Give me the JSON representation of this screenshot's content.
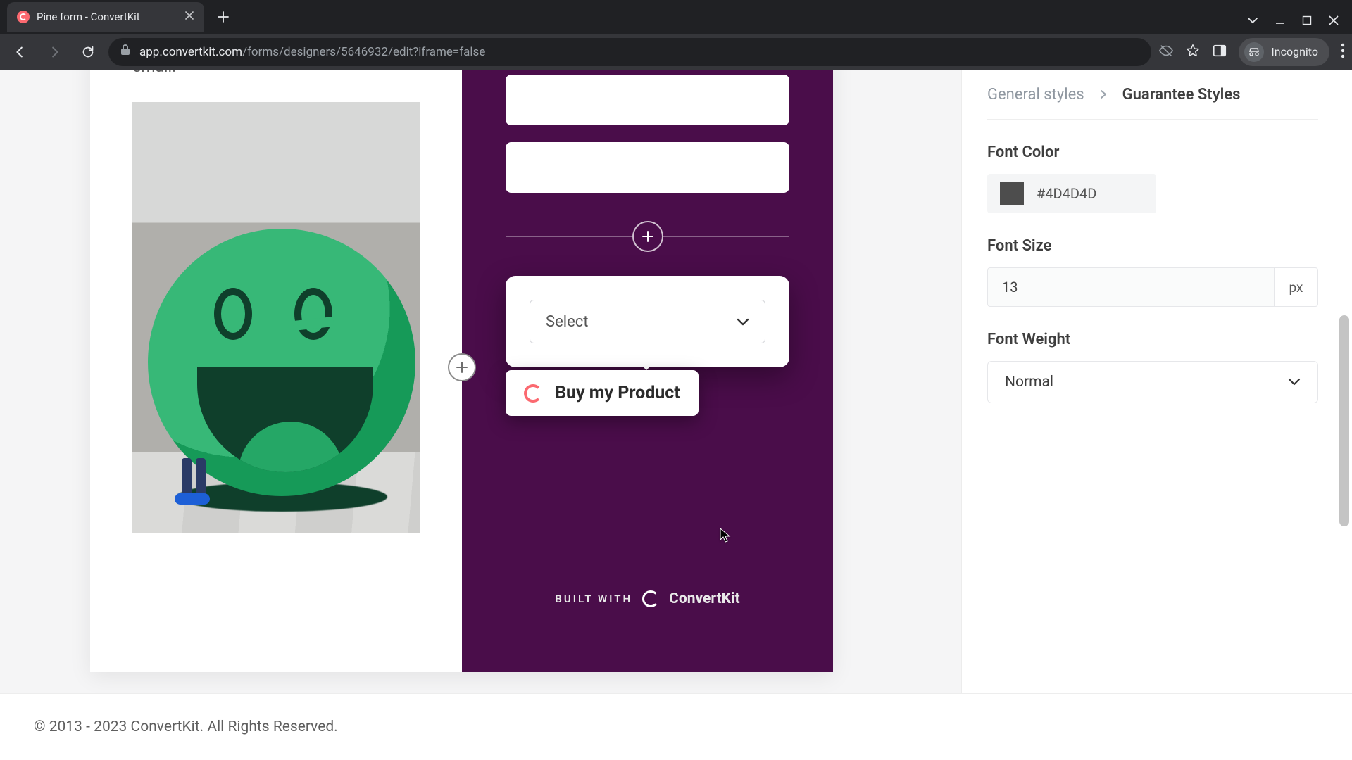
{
  "browser": {
    "tab_title": "Pine form - ConvertKit",
    "url_domain": "app.convertkit.com",
    "url_path": "/forms/designers/5646932/edit?iframe=false",
    "incognito_label": "Incognito"
  },
  "preview": {
    "intro_tail": "email.",
    "select_placeholder": "Select",
    "buy_label": "Buy my Product",
    "builtwith_prefix": "BUILT WITH",
    "builtwith_brand": "ConvertKit"
  },
  "sidebar": {
    "crumb_root": "General styles",
    "crumb_active": "Guarantee Styles",
    "font_color_label": "Font Color",
    "font_color_value": "#4D4D4D",
    "font_size_label": "Font Size",
    "font_size_value": "13",
    "font_size_unit": "px",
    "font_weight_label": "Font Weight",
    "font_weight_value": "Normal"
  },
  "footer": {
    "copyright": "© 2013 - 2023 ConvertKit. All Rights Reserved."
  }
}
